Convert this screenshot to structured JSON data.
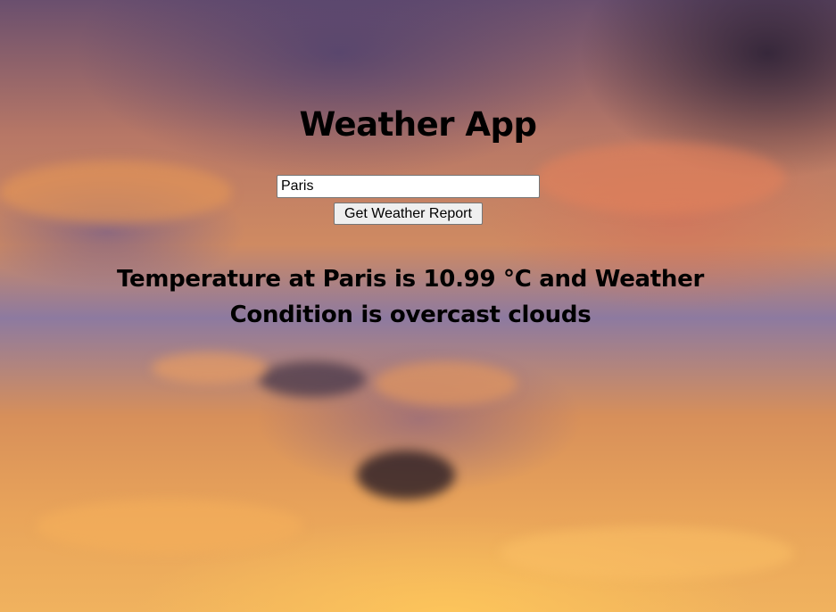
{
  "app": {
    "title": "Weather App"
  },
  "search": {
    "value": "Paris",
    "button_label": "Get Weather Report"
  },
  "report": {
    "line1": "Temperature at Paris is 10.99 °C and Weather",
    "line2": "Condition is overcast clouds",
    "city": "Paris",
    "temperature_c": 10.99,
    "condition": "overcast clouds"
  },
  "theme": {
    "text_color": "#000000",
    "background": "sunset-sky-photo"
  }
}
